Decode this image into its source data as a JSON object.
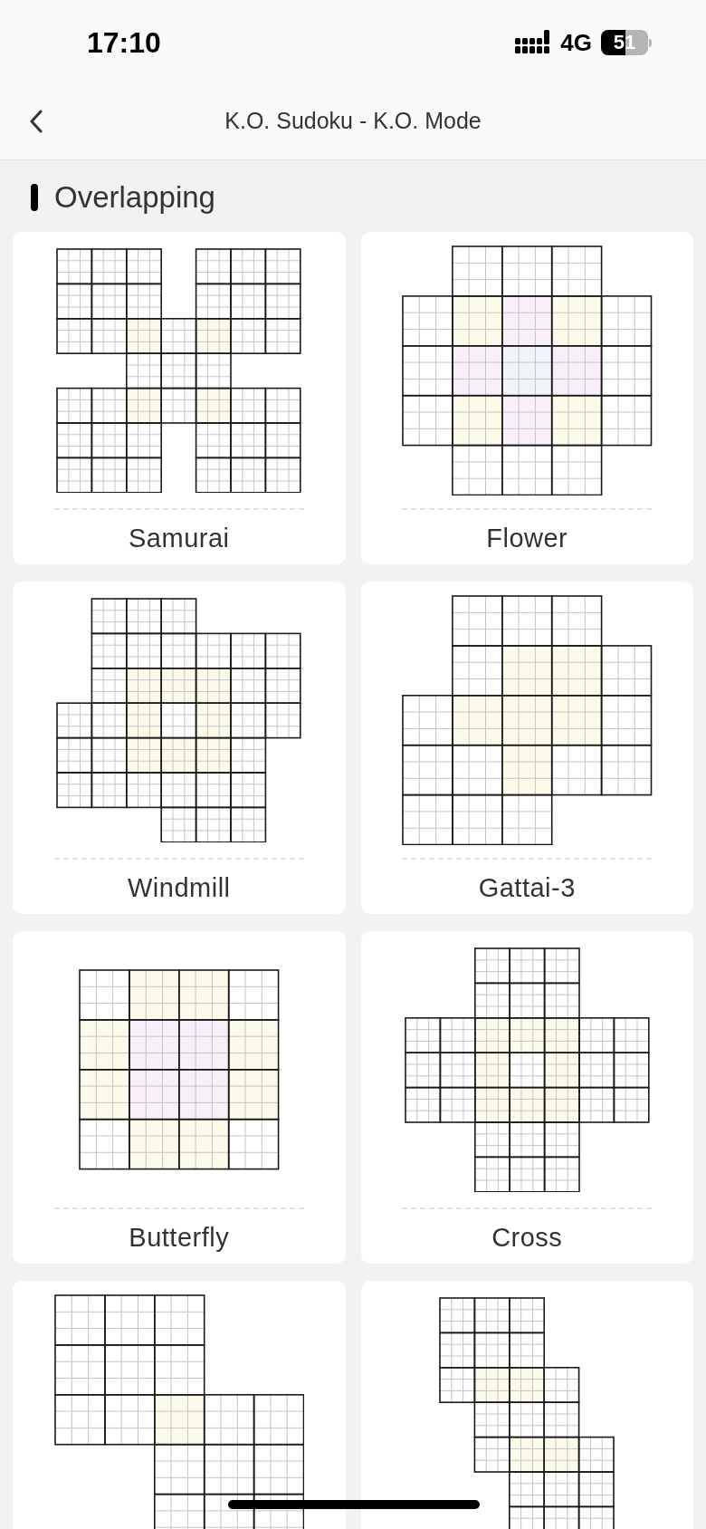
{
  "status_bar": {
    "time": "17:10",
    "network": "4G",
    "battery": "51"
  },
  "header": {
    "title": "K.O. Sudoku - K.O. Mode"
  },
  "section": {
    "title": "Overlapping"
  },
  "puzzles": [
    {
      "kind": "samurai",
      "label": "Samurai"
    },
    {
      "kind": "flower",
      "label": "Flower"
    },
    {
      "kind": "windmill",
      "label": "Windmill"
    },
    {
      "kind": "gattai",
      "label": "Gattai-3"
    },
    {
      "kind": "butterfly",
      "label": "Butterfly"
    },
    {
      "kind": "cross",
      "label": "Cross"
    },
    {
      "kind": "steps"
    },
    {
      "kind": "ladder"
    }
  ]
}
